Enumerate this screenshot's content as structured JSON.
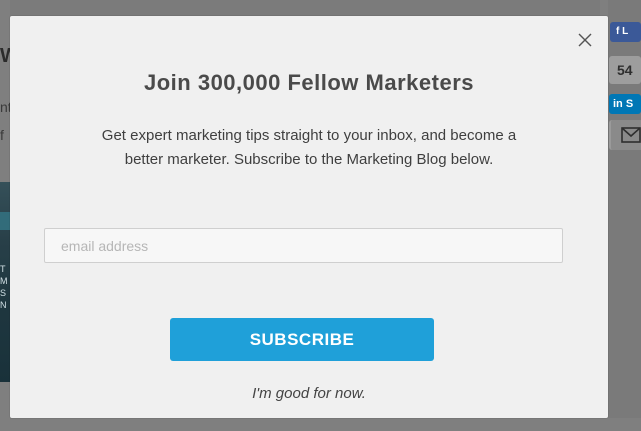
{
  "modal": {
    "close_symbol": "×",
    "title": "Join 300,000 Fellow Marketers",
    "description": "Get expert marketing tips straight to your inbox, and become a better marketer. Subscribe to the Marketing Blog below.",
    "email": {
      "placeholder": "email address",
      "value": ""
    },
    "subscribe_label": "SUBSCRIBE",
    "dismiss_label": "I'm good for now."
  },
  "background": {
    "left_letter": "W",
    "left_snippet_1": "nt",
    "left_snippet_2": "f",
    "left_image_texts": [
      "T",
      "M",
      "S",
      "N"
    ],
    "social": {
      "facebook_label": "f L",
      "count": "54",
      "linkedin_label": "in S",
      "mail_icon": "mail-icon"
    }
  },
  "colors": {
    "overlay": "#7f7f7f",
    "modal_bg": "#f0f0f0",
    "accent_button": "#1fa0d9",
    "facebook": "#3b5998",
    "linkedin": "#0077b5"
  }
}
